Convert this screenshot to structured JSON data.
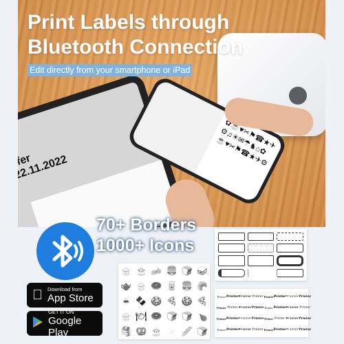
{
  "hero": {
    "title_line1": "Print Labels through",
    "title_line2": "Bluetooth Connection",
    "subtitle": "Edit directly from your smartphone or iPad"
  },
  "tablet": {
    "label_line1": "afer",
    "label_line2": "22.11.2022"
  },
  "features": {
    "borders": "70+ Borders",
    "icons": "1000+ Icons"
  },
  "stores": {
    "app_store": {
      "small": "Download from",
      "big": "App Store"
    },
    "google_play": {
      "small": "GET IT ON",
      "big": "Google Play"
    }
  },
  "icon_glyphs": [
    "🧁",
    "🎂",
    "🧀",
    "🍔",
    "🍞",
    "🥪",
    "🫖",
    "🧁",
    "🍩",
    "🥫",
    "🍔",
    "🥐",
    "🍝",
    "🍫",
    "🍪",
    "🍕",
    "🍪",
    "🍕",
    "🧁",
    "🍽",
    "🍩",
    "🍞",
    "🍞",
    "🍗",
    "🥞",
    "🥨",
    "🎂",
    "🥟",
    "🥖",
    "🍞"
  ],
  "font_samples": [
    "Printer",
    "Printer",
    "Printer",
    "Printer",
    "Printer",
    "Printer",
    "Printer",
    "Printer",
    "Printer",
    "Printer",
    "Printer",
    "Printer",
    "Printer",
    "Printer",
    "Printer",
    "Printer",
    "Printer",
    "Printer",
    "Printer",
    "Printer",
    "Printer",
    "Printer",
    "Printer",
    "Printer",
    "Printer",
    "Printer",
    "Printer",
    "Printer",
    "Printer",
    "Printer",
    "Printer",
    "Printer"
  ],
  "colors": {
    "bluetooth": "#1f7de0",
    "subtitle_bg": "#7fb2dc",
    "store_bg": "#0b0b0b"
  }
}
